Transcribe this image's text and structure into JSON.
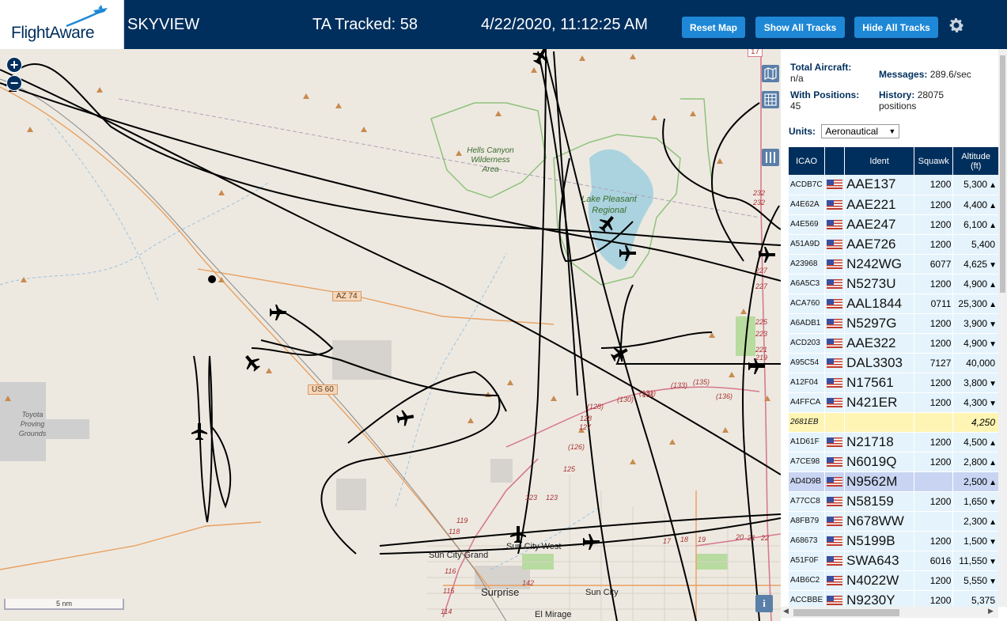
{
  "header": {
    "logo_text": "FlightAware",
    "app_title": "SKYVIEW",
    "tracked": "TA Tracked: 58",
    "clock": "4/22/2020, 11:12:25 AM",
    "reset_map": "Reset Map",
    "show_all": "Show All Tracks",
    "hide_all": "Hide All Tracks",
    "settings_icon": "gear-icon"
  },
  "map": {
    "zoom_in": "+",
    "zoom_out": "−",
    "scale": "5 nm",
    "info": "i",
    "labels": {
      "hells_canyon": [
        "Hells Canyon",
        "Wilderness",
        "Area"
      ],
      "lake_pleasant": [
        "Lake Pleasant",
        "Regional"
      ],
      "toyota": [
        "Toyota",
        "Proving",
        "Grounds"
      ],
      "az74": "AZ 74",
      "us60": "US 60",
      "sun_city_west": "Sun City West",
      "sun_city_grand": "Sun City Grand",
      "surprise": "Surprise",
      "sun_city": "Sun City",
      "el_mirage": "El Mirage",
      "r17": "17"
    },
    "road_numbers": [
      "232",
      "232",
      "227",
      "227",
      "225",
      "223",
      "221",
      "219",
      "(130)",
      "(131)",
      "131",
      "(133)",
      "(135)",
      "(136)",
      "(128)",
      "128",
      "127",
      "(126)",
      "125",
      "123",
      "123",
      "119",
      "118",
      "116",
      "115",
      "114",
      "142",
      "17",
      "18",
      "19",
      "20",
      "21",
      "22"
    ]
  },
  "panel": {
    "total_label": "Total Aircraft:",
    "total_value": "n/a",
    "messages_label": "Messages:",
    "messages_value": "289.6/sec",
    "positions_label": "With Positions:",
    "positions_value": "45",
    "history_label": "History:",
    "history_value": "28075",
    "history_unit": "positions",
    "units_label": "Units:",
    "units_value": "Aeronautical"
  },
  "table": {
    "headers": {
      "icao": "ICAO",
      "ident": "Ident",
      "squawk": "Squawk",
      "altitude": "Altitude",
      "altitude_unit": "(ft)"
    },
    "rows": [
      {
        "icao": "ACDB7C",
        "flag": true,
        "ident": "AAE137",
        "squawk": "1200",
        "alt": "5,300",
        "trend": "▲"
      },
      {
        "icao": "A4E62A",
        "flag": true,
        "ident": "AAE221",
        "squawk": "1200",
        "alt": "4,400",
        "trend": "▲"
      },
      {
        "icao": "A4E569",
        "flag": true,
        "ident": "AAE247",
        "squawk": "1200",
        "alt": "6,100",
        "trend": "▲"
      },
      {
        "icao": "A51A9D",
        "flag": true,
        "ident": "AAE726",
        "squawk": "1200",
        "alt": "5,400",
        "trend": ""
      },
      {
        "icao": "A23968",
        "flag": true,
        "ident": "N242WG",
        "squawk": "6077",
        "alt": "4,625",
        "trend": "▼"
      },
      {
        "icao": "A6A5C3",
        "flag": true,
        "ident": "N5273U",
        "squawk": "1200",
        "alt": "4,900",
        "trend": "▲"
      },
      {
        "icao": "ACA760",
        "flag": true,
        "ident": "AAL1844",
        "squawk": "0711",
        "alt": "25,300",
        "trend": "▲"
      },
      {
        "icao": "A6ADB1",
        "flag": true,
        "ident": "N5297G",
        "squawk": "1200",
        "alt": "3,900",
        "trend": "▼"
      },
      {
        "icao": "ACD203",
        "flag": true,
        "ident": "AAE322",
        "squawk": "1200",
        "alt": "4,900",
        "trend": "▼"
      },
      {
        "icao": "A95C54",
        "flag": true,
        "ident": "DAL3303",
        "squawk": "7127",
        "alt": "40,000",
        "trend": ""
      },
      {
        "icao": "A12F04",
        "flag": true,
        "ident": "N17561",
        "squawk": "1200",
        "alt": "3,800",
        "trend": "▼"
      },
      {
        "icao": "A4FFCA",
        "flag": true,
        "ident": "N421ER",
        "squawk": "1200",
        "alt": "4,300",
        "trend": "▼"
      },
      {
        "icao": "2681EB",
        "flag": false,
        "ident": "",
        "squawk": "",
        "alt": "4,250",
        "trend": "",
        "mlat": true
      },
      {
        "icao": "A1D61F",
        "flag": true,
        "ident": "N21718",
        "squawk": "1200",
        "alt": "4,500",
        "trend": "▲"
      },
      {
        "icao": "A7CE98",
        "flag": true,
        "ident": "N6019Q",
        "squawk": "1200",
        "alt": "2,800",
        "trend": "▲"
      },
      {
        "icao": "AD4D9B",
        "flag": true,
        "ident": "N9562M",
        "squawk": "",
        "alt": "2,500",
        "trend": "▲",
        "selected": true
      },
      {
        "icao": "A77CC8",
        "flag": true,
        "ident": "N58159",
        "squawk": "1200",
        "alt": "1,650",
        "trend": "▼"
      },
      {
        "icao": "A8FB79",
        "flag": true,
        "ident": "N678WW",
        "squawk": "",
        "alt": "2,300",
        "trend": "▲"
      },
      {
        "icao": "A68673",
        "flag": true,
        "ident": "N5199B",
        "squawk": "1200",
        "alt": "1,500",
        "trend": "▼"
      },
      {
        "icao": "A51F0F",
        "flag": true,
        "ident": "SWA643",
        "squawk": "6016",
        "alt": "11,550",
        "trend": "▼"
      },
      {
        "icao": "A4B6C2",
        "flag": true,
        "ident": "N4022W",
        "squawk": "1200",
        "alt": "5,550",
        "trend": "▼"
      },
      {
        "icao": "ACCBBE",
        "flag": true,
        "ident": "N9230Y",
        "squawk": "1200",
        "alt": "5,375",
        "trend": ""
      }
    ]
  },
  "icons": {
    "map_layers": "map-icon",
    "grid": "grid-icon",
    "columns": "columns-icon",
    "plane": "airplane-icon"
  },
  "colors": {
    "header_bg": "#002f5d",
    "button_bg": "#1e88d6",
    "row_bg": "#e5f3fc",
    "row_mlat": "#fef5b5",
    "row_selected": "#c8d4f2",
    "track": "#000000"
  }
}
